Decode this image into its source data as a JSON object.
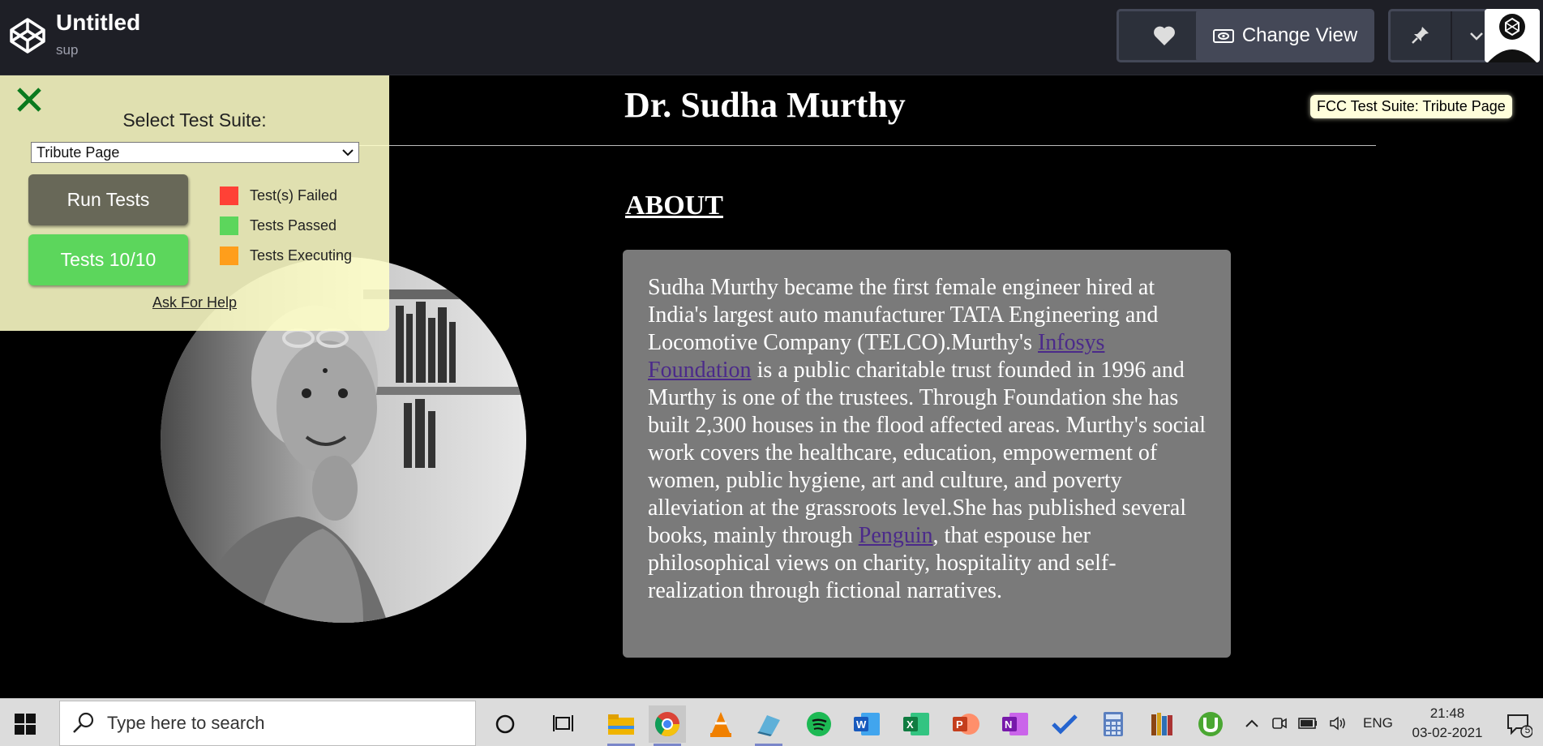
{
  "header": {
    "title": "Untitled",
    "subtitle": "sup",
    "change_view_label": "Change View"
  },
  "page": {
    "heading": "Dr. Sudha Murthy",
    "fcc_badge": "FCC Test Suite: Tribute Page",
    "about_heading": "ABOUT",
    "about_text_1": "Sudha Murthy became the first female engineer hired at India's largest auto manufacturer TATA Engineering and Locomotive Company (TELCO).Murthy's ",
    "link_infosys": "Infosys Foundation",
    "about_text_2": " is a public charitable trust founded in 1996 and Murthy is one of the trustees. Through Foundation she has built 2,300 houses in the flood affected areas. Murthy's social work covers the healthcare, education, empowerment of women, public hygiene, art and culture, and poverty alleviation at the grassroots level.She has published several books, mainly through ",
    "link_penguin": "Penguin",
    "about_text_3": ", that espouse her philosophical views on charity, hospitality and self-realization through fictional narratives."
  },
  "fcc_panel": {
    "select_label": "Select Test Suite:",
    "selected_suite": "Tribute Page",
    "run_tests_label": "Run Tests",
    "tests_result_label": "Tests 10/10",
    "legend": [
      {
        "label": "Test(s) Failed",
        "color": "#ff4136"
      },
      {
        "label": "Tests Passed",
        "color": "#5cd65c"
      },
      {
        "label": "Tests Executing",
        "color": "#ff9e1b"
      }
    ],
    "help_link": "Ask For Help"
  },
  "taskbar": {
    "search_placeholder": "Type here to search",
    "language": "ENG",
    "time": "21:48",
    "date": "03-02-2021",
    "notification_count": "5"
  }
}
